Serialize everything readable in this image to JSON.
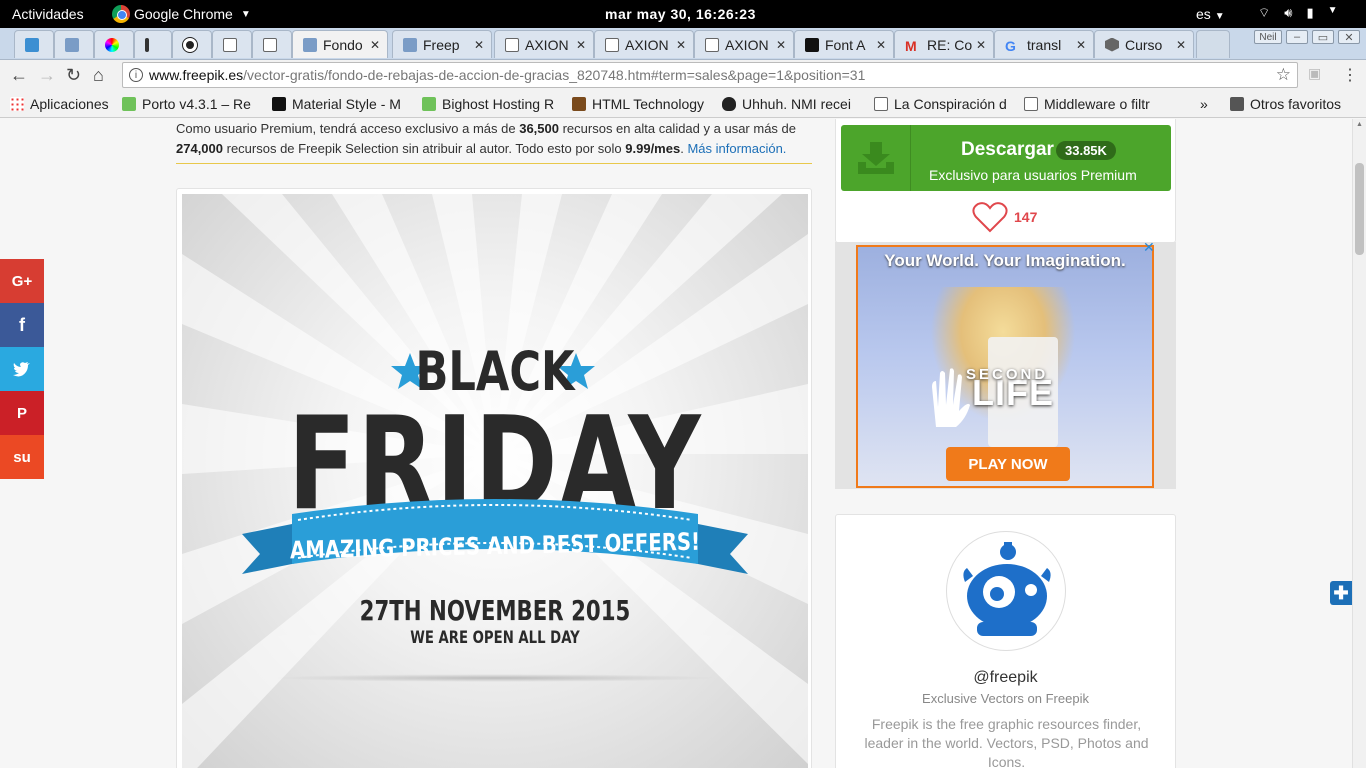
{
  "system_bar": {
    "activities": "Actividades",
    "app_name": "Google Chrome",
    "clock": "mar may 30, 16:26:23",
    "language": "es"
  },
  "tabs": [
    {
      "label": ""
    },
    {
      "label": ""
    },
    {
      "label": ""
    },
    {
      "label": ""
    },
    {
      "label": ""
    },
    {
      "label": ""
    },
    {
      "label": ""
    },
    {
      "label": "Fondo"
    },
    {
      "label": "Freep"
    },
    {
      "label": "AXION"
    },
    {
      "label": "AXION"
    },
    {
      "label": "AXION"
    },
    {
      "label": "Font A"
    },
    {
      "label": "RE: Co"
    },
    {
      "label": "transl"
    },
    {
      "label": "Curso"
    }
  ],
  "profile_badge": "Neil",
  "address_bar": {
    "domain": "www.freepik.es",
    "path": "/vector-gratis/fondo-de-rebajas-de-accion-de-gracias_820748.htm#term=sales&page=1&position=31"
  },
  "bookmarks": [
    {
      "label": "Aplicaciones"
    },
    {
      "label": "Porto v4.3.1 – Re"
    },
    {
      "label": "Material Style - M"
    },
    {
      "label": "Bighost Hosting R"
    },
    {
      "label": "HTML Technology"
    },
    {
      "label": "Uhhuh. NMI recei"
    },
    {
      "label": "La Conspiración d"
    },
    {
      "label": "Middleware o filtr"
    },
    {
      "label": "Otros favoritos"
    }
  ],
  "notice": {
    "t1": "Como usuario Premium, tendrá acceso exclusivo a más de ",
    "n1": "36,500",
    "t2": " recursos en alta calidad y a usar más de",
    "n2": "274,000",
    "t3": " recursos de Freepik Selection sin atribuir al autor. Todo esto por solo ",
    "price": "9.99/mes",
    "t4": ". ",
    "link": "Más información."
  },
  "preview": {
    "line1": "BLACK",
    "line2": "FRIDAY",
    "ribbon": "AMAZING PRICES AND BEST OFFERS!",
    "date": "27TH NOVEMBER 2015",
    "open": "WE ARE OPEN ALL DAY"
  },
  "social": [
    {
      "label": "G+",
      "color": "#d73d32"
    },
    {
      "label": "f",
      "color": "#3b5998"
    },
    {
      "label": "t",
      "color": "#1da1f2"
    },
    {
      "label": "P",
      "color": "#cb2027"
    },
    {
      "label": "su",
      "color": "#eb4924"
    }
  ],
  "download": {
    "label": "Descargar",
    "count": "33.85K",
    "sub": "Exclusivo para usuarios Premium",
    "likes": "147",
    "color": "#4ca52b"
  },
  "ad": {
    "headline": "Your World. Your Imagination.",
    "brand_top": "SECOND",
    "brand_bottom": "LIFE",
    "cta": "PLAY NOW"
  },
  "profile": {
    "handle": "@freepik",
    "subtitle": "Exclusive Vectors on Freepik",
    "description": "Freepik is the free graphic resources finder, leader in the world. Vectors, PSD, Photos and Icons."
  }
}
